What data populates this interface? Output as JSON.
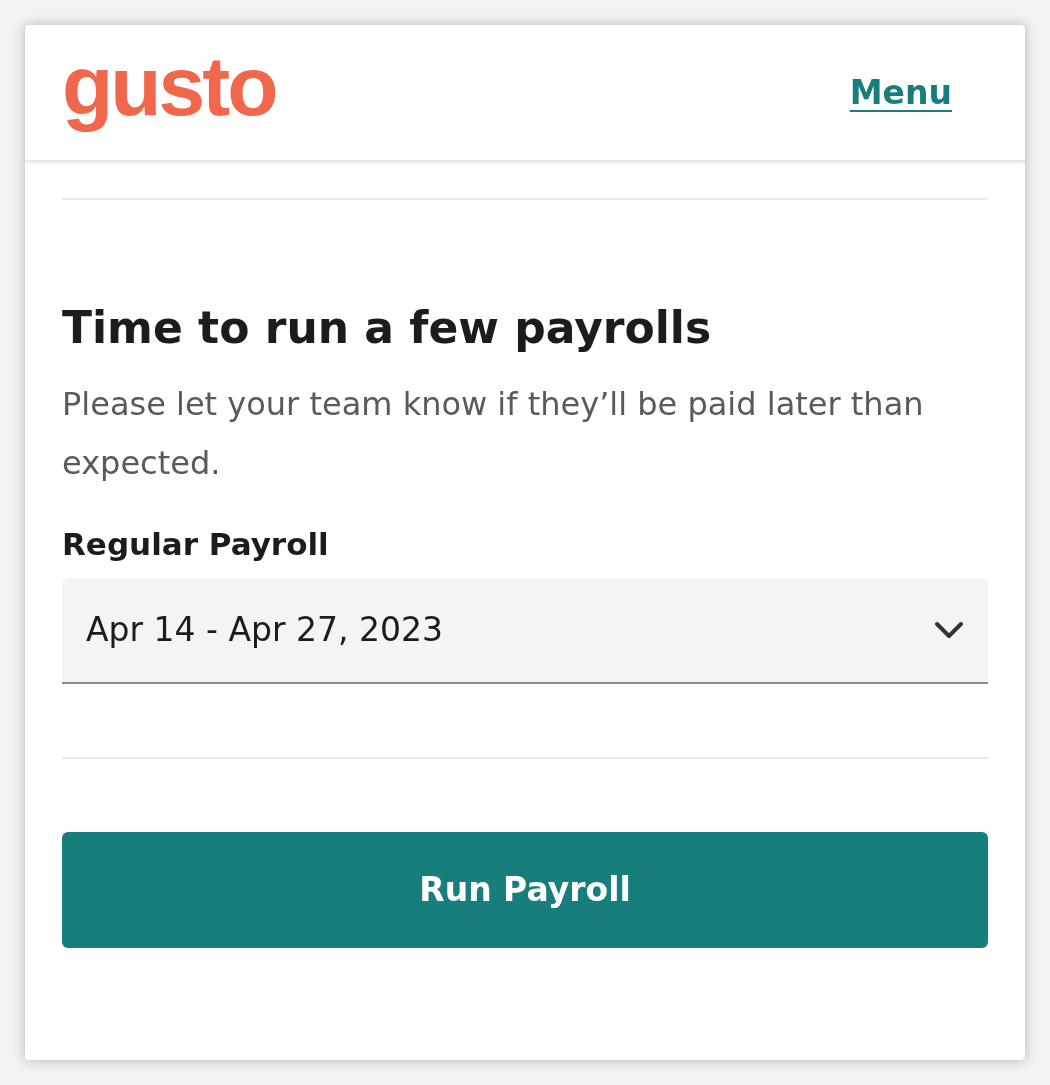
{
  "header": {
    "logo": "gusto",
    "menu_link": "Menu"
  },
  "title": "Time to run a few payrolls",
  "description": "Please let your team know if they’ll be paid later than expected.",
  "payroll_select": {
    "label": "Regular Payroll",
    "value": "Apr 14 - Apr 27, 2023"
  },
  "primary_button": "Run Payroll"
}
